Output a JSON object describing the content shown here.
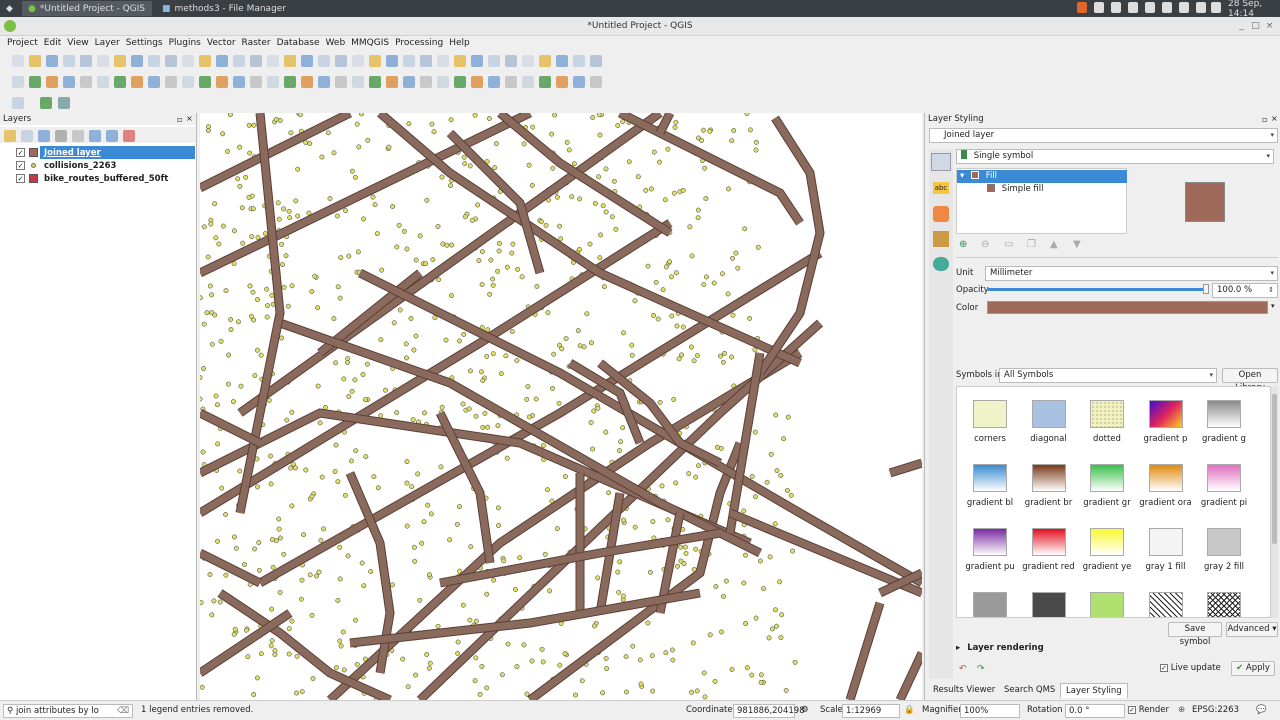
{
  "taskbar": {
    "task1": "*Untitled Project - QGIS",
    "task2": "methods3 - File Manager",
    "clock": "28 Sep, 14:14"
  },
  "window": {
    "title": "*Untitled Project - QGIS"
  },
  "menus": [
    "Project",
    "Edit",
    "View",
    "Layer",
    "Settings",
    "Plugins",
    "Vector",
    "Raster",
    "Database",
    "Web",
    "MMQGIS",
    "Processing",
    "Help"
  ],
  "layers_panel": {
    "title": "Layers",
    "items": [
      {
        "label": "Joined layer",
        "color": "#a06a5a",
        "selected": true
      },
      {
        "label": "collisions_2263",
        "color": "#d4d44a",
        "selected": false
      },
      {
        "label": "bike_routes_buffered_50ft",
        "color": "#c03a4a",
        "selected": false
      }
    ]
  },
  "style_panel": {
    "title": "Layer Styling",
    "layer_select": "Joined layer",
    "renderer": "Single symbol",
    "tree": {
      "fill": "Fill",
      "simple_fill": "Simple fill"
    },
    "symbol_color": "#a06a5a",
    "unit_label": "Unit",
    "unit_value": "Millimeter",
    "opacity_label": "Opacity",
    "opacity_value": "100.0 %",
    "opacity_fraction": 1.0,
    "color_label": "Color",
    "symbols_in_label": "Symbols in",
    "symbols_in_value": "All Symbols",
    "open_library": "Open Library",
    "symbols": [
      {
        "label": "corners",
        "color": "#eef3c8"
      },
      {
        "label": "diagonal",
        "color": "#a9c2e2"
      },
      {
        "label": "dotted",
        "color": "#f0f0c0"
      },
      {
        "label": "gradient  p",
        "color": "#8a2ad0"
      },
      {
        "label": "gradient  g",
        "color": "#8a8a8a"
      },
      {
        "label": "gradient bl",
        "color": "#3a8ad0"
      },
      {
        "label": "gradient br",
        "color": "#7a3a1a"
      },
      {
        "label": "gradient gr",
        "color": "#3ac04a"
      },
      {
        "label": "gradient ora",
        "color": "#e08a10"
      },
      {
        "label": "gradient pi",
        "color": "#e070c0"
      },
      {
        "label": "gradient pu",
        "color": "#7a2aa0"
      },
      {
        "label": "gradient red",
        "color": "#e01020"
      },
      {
        "label": "gradient ye",
        "color": "#f8f830"
      },
      {
        "label": "gray 1 fill",
        "color": "#f4f4f4"
      },
      {
        "label": "gray 2 fill",
        "color": "#c8c8c8"
      },
      {
        "label": "",
        "color": "#9a9a9a"
      },
      {
        "label": "",
        "color": "#4a4a4a"
      },
      {
        "label": "",
        "color": "#b0e070"
      },
      {
        "label": "",
        "color": "#ffffff"
      },
      {
        "label": "",
        "color": "#ffffff"
      }
    ],
    "save_symbol": "Save symbol",
    "advanced": "Advanced",
    "layer_rendering": "Layer rendering",
    "live_update": "Live update",
    "apply": "Apply"
  },
  "bottom_tabs": [
    "Results Viewer",
    "Search QMS",
    "Layer Styling"
  ],
  "statusbar": {
    "search_placeholder": "join attributes by lo",
    "message": "1 legend entries removed.",
    "coordinate_label": "Coordinate",
    "coordinate_value": "981886,204198",
    "scale_label": "Scale",
    "scale_value": "1:12969",
    "magnifier_label": "Magnifier",
    "magnifier_value": "100%",
    "rotation_label": "Rotation",
    "rotation_value": "0.0 °",
    "render_label": "Render",
    "crs": "EPSG:2263"
  },
  "colors": {
    "roads": "#8b6a5e",
    "points": "#dede6a",
    "selection": "#3a8ad6"
  }
}
